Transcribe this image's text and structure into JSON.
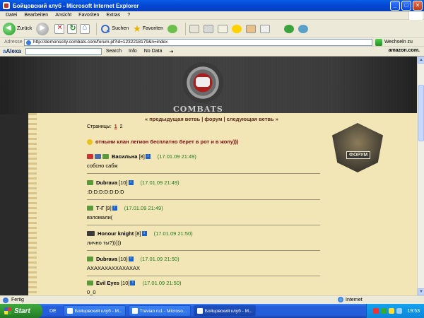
{
  "window": {
    "title": "Бойцовский клуб - Microsoft Internet Explorer",
    "min_label": "_",
    "max_label": "□",
    "close_label": "✕"
  },
  "menu": [
    "Datei",
    "Bearbeiten",
    "Ansicht",
    "Favoriten",
    "Extras",
    "?"
  ],
  "toolbar": {
    "back_label": "Zurück",
    "search_label": "Suchen",
    "favorites_label": "Favoriten"
  },
  "address": {
    "label": "Adresse",
    "url": "http://demonscity.combats.com/forum.pl?id=1232218179&n=index",
    "go_label": "Wechseln zu"
  },
  "alexa": {
    "logo": "Alexa",
    "search_label": "Search",
    "info_label": "Info",
    "nodata_label": "No Data",
    "amazon_label": "amazon.com."
  },
  "site": {
    "logo_text": "COMBATS",
    "forum_badge": "ФОРУМ",
    "nav": {
      "prev": "« предыдущая ветвь",
      "forum": "форум",
      "next": "следующая ветвь »"
    },
    "pages_label": "Страницы:",
    "pages": [
      "1",
      "2"
    ],
    "current_page": "1",
    "thread_title": "отныни клан легион бесплатно берет в рот и в жопу)))"
  },
  "posts": [
    {
      "nick": "Васильна",
      "level": "[8]",
      "date": "(17.01.09 21:49)",
      "text": "собсно сабж"
    },
    {
      "nick": "Dubrava",
      "level": "[10]",
      "date": "(17.01.09 21:49)",
      "text": ":D:D:D:D:D:D:D"
    },
    {
      "nick": "Т-Г",
      "level": "[9]",
      "date": "(17.01.09 21:49)",
      "text": "взломали("
    },
    {
      "nick": "Honour knight",
      "level": "[8]",
      "date": "(17.01.09 21:50)",
      "text": "лично ты?)))))"
    },
    {
      "nick": "Dubrava",
      "level": "[10]",
      "date": "(17.01.09 21:50)",
      "text": "АХАХАХАХХАХАХАХ"
    },
    {
      "nick": "Evil Eyes",
      "level": "[10]",
      "date": "(17.01.09 21:50)",
      "text": "0_0"
    }
  ],
  "statusbar": {
    "status": "Fertig",
    "zone": "Internet"
  },
  "taskbar": {
    "start_label": "Start",
    "lang": "DE",
    "tasks": [
      "Бойцовский клуб - М...",
      "Travian ru1 - Microso...",
      "Бойцовский клуб - М..."
    ],
    "clock": "19:53"
  }
}
